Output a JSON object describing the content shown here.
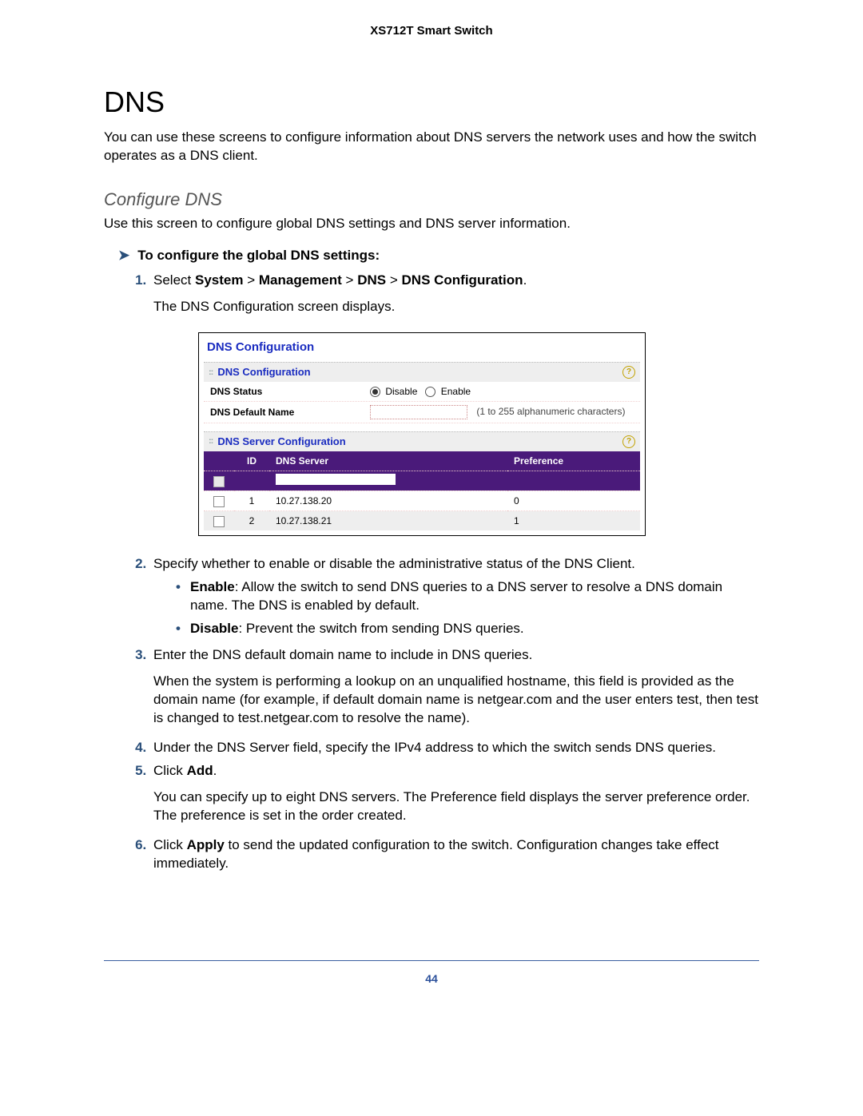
{
  "doc_title": "XS712T Smart Switch",
  "section_heading": "DNS",
  "intro": "You can use these screens to configure information about DNS servers the network uses and how the switch operates as a DNS client.",
  "subheading": "Configure DNS",
  "sub_intro": "Use this screen to configure global DNS settings and DNS server information.",
  "task_title": "To configure the global DNS settings:",
  "step1_prefix": "Select ",
  "nav": {
    "a": "System",
    "b": "Management",
    "c": "DNS",
    "d": "DNS Configuration"
  },
  "nav_sep": ">",
  "step1_after": "The DNS Configuration screen displays.",
  "figure": {
    "panel_title_main": "DNS Configuration",
    "panel_title_1": "DNS Configuration",
    "row_status_label": "DNS Status",
    "radio_disable": "Disable",
    "radio_enable": "Enable",
    "row_name_label": "DNS Default Name",
    "name_hint": "(1 to 255 alphanumeric characters)",
    "panel_title_2": "DNS Server Configuration",
    "col_id": "ID",
    "col_server": "DNS Server",
    "col_pref": "Preference",
    "rows": [
      {
        "id": "1",
        "server": "10.27.138.20",
        "pref": "0"
      },
      {
        "id": "2",
        "server": "10.27.138.21",
        "pref": "1"
      }
    ]
  },
  "step2": "Specify whether to enable or disable the administrative status of the DNS Client.",
  "step2_enable_label": "Enable",
  "step2_enable_text": ": Allow the switch to send DNS queries to a DNS server to resolve a DNS domain name. The DNS is enabled by default.",
  "step2_disable_label": "Disable",
  "step2_disable_text": ": Prevent the switch from sending DNS queries.",
  "step3": "Enter the DNS default domain name to include in DNS queries.",
  "step3_after": "When the system is performing a lookup on an unqualified hostname, this field is provided as the domain name (for example, if default domain name is netgear.com and the user enters test, then test is changed to test.netgear.com to resolve the name).",
  "step4": "Under the DNS Server field, specify the IPv4 address to which the switch sends DNS queries.",
  "step5_prefix": "Click ",
  "step5_bold": "Add",
  "step5_suffix": ".",
  "step5_after": "You can specify up to eight DNS servers. The Preference field displays the server preference order. The preference is set in the order created.",
  "step6_prefix": "Click ",
  "step6_bold": "Apply",
  "step6_suffix": " to send the updated configuration to the switch. Configuration changes take effect immediately.",
  "page_number": "44"
}
